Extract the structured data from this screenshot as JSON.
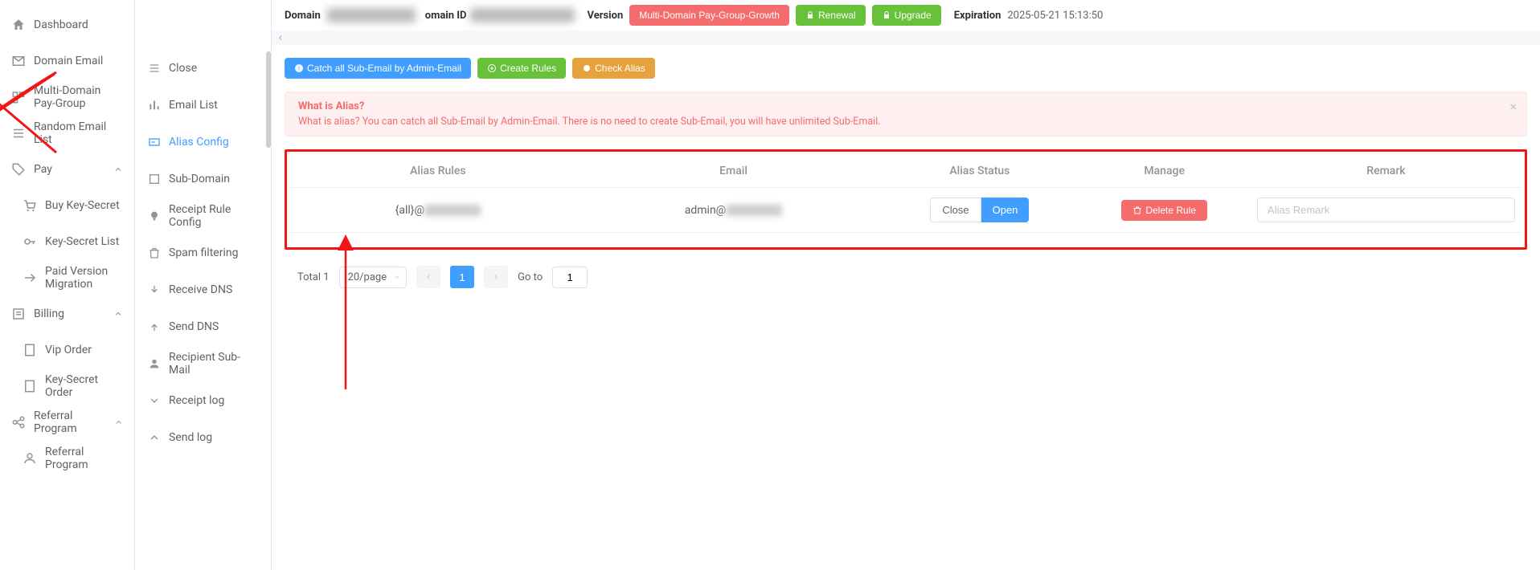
{
  "sidebar": {
    "items": [
      {
        "name": "dashboard",
        "label": "Dashboard"
      },
      {
        "name": "domain-email",
        "label": "Domain Email"
      },
      {
        "name": "multi-domain-pay-group",
        "label": "Multi-Domain Pay-Group"
      },
      {
        "name": "random-email-list",
        "label": "Random Email List"
      },
      {
        "name": "pay",
        "label": "Pay",
        "expandable": true
      },
      {
        "name": "buy-key-secret",
        "label": "Buy Key-Secret",
        "sub": true
      },
      {
        "name": "key-secret-list",
        "label": "Key-Secret List",
        "sub": true
      },
      {
        "name": "paid-version-migration",
        "label": "Paid Version Migration",
        "sub": true
      },
      {
        "name": "billing",
        "label": "Billing",
        "expandable": true
      },
      {
        "name": "vip-order",
        "label": "Vip Order",
        "sub": true
      },
      {
        "name": "key-secret-order",
        "label": "Key-Secret Order",
        "sub": true
      },
      {
        "name": "referral-program",
        "label": "Referral Program",
        "expandable": true
      },
      {
        "name": "referral-program-sub",
        "label": "Referral Program",
        "sub": true
      }
    ]
  },
  "midpanel": {
    "items": [
      {
        "name": "close",
        "label": "Close"
      },
      {
        "name": "email-list",
        "label": "Email List"
      },
      {
        "name": "alias-config",
        "label": "Alias Config",
        "active": true
      },
      {
        "name": "sub-domain",
        "label": "Sub-Domain"
      },
      {
        "name": "receipt-rule-config",
        "label": "Receipt Rule Config"
      },
      {
        "name": "spam-filtering",
        "label": "Spam filtering"
      },
      {
        "name": "receive-dns",
        "label": "Receive DNS"
      },
      {
        "name": "send-dns",
        "label": "Send DNS"
      },
      {
        "name": "recipient-sub-mail",
        "label": "Recipient Sub-Mail"
      },
      {
        "name": "receipt-log",
        "label": "Receipt log"
      },
      {
        "name": "send-log",
        "label": "Send log"
      }
    ]
  },
  "topbar": {
    "domain_label": "Domain",
    "domain_id_label": "omain ID",
    "version_label": "Version",
    "version_btn": "Multi-Domain Pay-Group-Growth",
    "renewal_btn": "Renewal",
    "upgrade_btn": "Upgrade",
    "expiration_label": "Expiration",
    "expiration_value": "2025-05-21 15:13:50"
  },
  "actions": {
    "catch_all": "Catch all Sub-Email by Admin-Email",
    "create_rules": "Create Rules",
    "check_alias": "Check Alias"
  },
  "alert": {
    "title": "What is Alias?",
    "desc": "What is alias? You can catch all Sub-Email by Admin-Email. There is no need to create Sub-Email, you will have unlimited Sub-Email."
  },
  "table": {
    "headers": {
      "rules": "Alias Rules",
      "email": "Email",
      "status": "Alias Status",
      "manage": "Manage",
      "remark": "Remark"
    },
    "row": {
      "rules_prefix": "{all}@",
      "email_prefix": "admin@",
      "close_btn": "Close",
      "open_btn": "Open",
      "delete_btn": "Delete Rule",
      "remark_placeholder": "Alias Remark"
    }
  },
  "pagination": {
    "total_label": "Total 1",
    "pagesize": "20/page",
    "page": "1",
    "goto_label": "Go to",
    "goto_value": "1"
  }
}
